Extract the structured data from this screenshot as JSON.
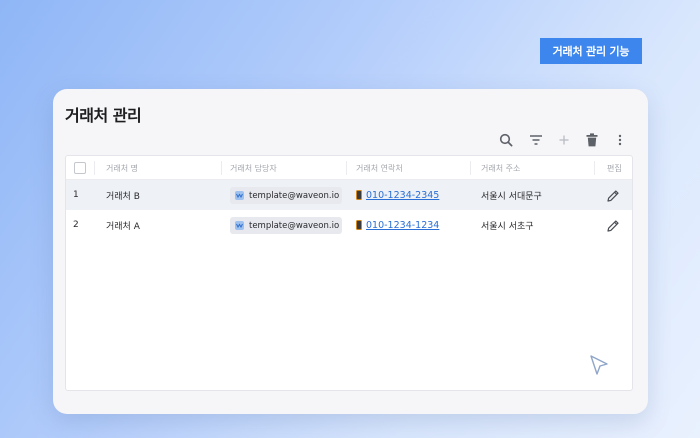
{
  "feature_badge": "거래처 관리 기능",
  "panel": {
    "title": "거래처 관리"
  },
  "toolbar": {
    "icons": [
      "search-icon",
      "filter-icon",
      "add-icon",
      "delete-icon",
      "more-icon"
    ]
  },
  "table": {
    "columns": [
      "거래처 명",
      "거래처 담당자",
      "거래처 연락처",
      "거래처 주소",
      "편집"
    ],
    "rows": [
      {
        "index": "1",
        "name": "거래처 B",
        "manager": "template@waveon.io",
        "phone": "010-1234-2345",
        "address": "서울시 서대문구"
      },
      {
        "index": "2",
        "name": "거래처 A",
        "manager": "template@waveon.io",
        "phone": "010-1234-1234",
        "address": "서울시 서초구"
      }
    ]
  },
  "colors": {
    "accent": "#3d86ee",
    "link": "#2a6fd6",
    "selected_row": "#eef1f6"
  }
}
